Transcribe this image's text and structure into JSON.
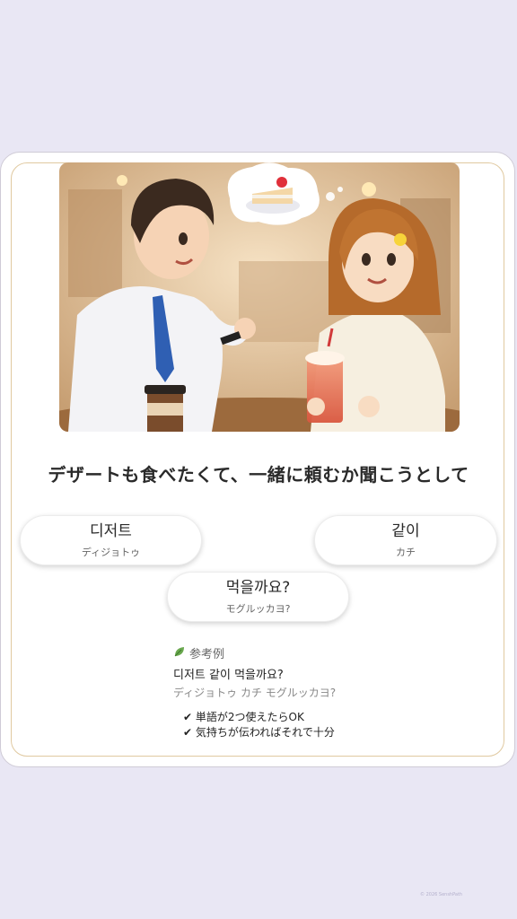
{
  "prompt": "デザートも食べたくて、一緒に頼むか聞こうとして",
  "chips": [
    {
      "korean": "디저트",
      "katakana": "ディジョトゥ"
    },
    {
      "korean": "같이",
      "katakana": "カチ"
    },
    {
      "korean": "먹을까요?",
      "katakana": "モグルッカヨ?"
    }
  ],
  "example": {
    "icon": "leaf-icon",
    "label": "参考例",
    "korean": "디저트 같이 먹을까요?",
    "katakana": "ディジョトゥ カチ モグルッカヨ?"
  },
  "checks": [
    "✔ 単語が2つ使えたらOK",
    "✔ 気持ちが伝わればそれで十分"
  ],
  "copyright": "© 2026 SenshPath",
  "colors": {
    "background": "#e9e7f4",
    "card_border": "#e0c9a0",
    "tie": "#2f5fb3"
  }
}
